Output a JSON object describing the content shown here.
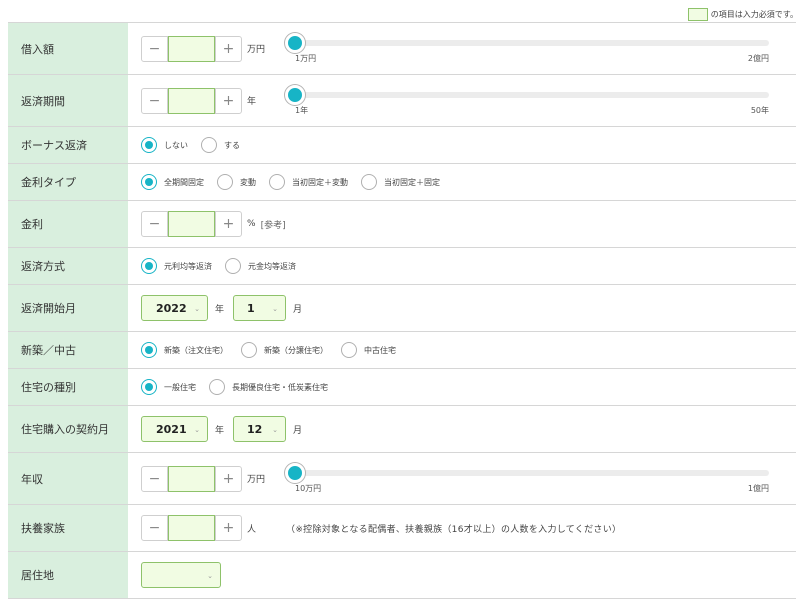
{
  "required_note": "の項目は入力必須です。",
  "colors": {
    "label_bg": "#d9efde",
    "required_bg": "#f1fce3",
    "required_border": "#8ec26a",
    "accent": "#17b4c6"
  },
  "loan_amount": {
    "label": "借入額",
    "minus": "−",
    "plus": "+",
    "value": "",
    "unit": "万円",
    "slider_min": "1万円",
    "slider_max": "2億円",
    "slider_fraction": 0
  },
  "term": {
    "label": "返済期間",
    "minus": "−",
    "plus": "+",
    "value": "",
    "unit": "年",
    "slider_min": "1年",
    "slider_max": "50年",
    "slider_fraction": 0
  },
  "bonus": {
    "label": "ボーナス返済",
    "options": [
      "しない",
      "する"
    ],
    "selected": 0
  },
  "rate_type": {
    "label": "金利タイプ",
    "options": [
      "全期間固定",
      "変動",
      "当初固定＋変動",
      "当初固定＋固定"
    ],
    "selected": 0
  },
  "rate": {
    "label": "金利",
    "minus": "−",
    "plus": "+",
    "value": "",
    "unit": "%",
    "ref": "[参考]"
  },
  "method": {
    "label": "返済方式",
    "options": [
      "元利均等返済",
      "元金均等返済"
    ],
    "selected": 0
  },
  "start_month": {
    "label": "返済開始月",
    "year": "2022",
    "year_unit": "年",
    "month": "1",
    "month_unit": "月"
  },
  "new_used": {
    "label": "新築／中古",
    "options": [
      "新築（注文住宅）",
      "新築（分譲住宅）",
      "中古住宅"
    ],
    "selected": 0
  },
  "house_type": {
    "label": "住宅の種別",
    "options": [
      "一般住宅",
      "長期優良住宅・低炭素住宅"
    ],
    "selected": 0
  },
  "contract": {
    "label": "住宅購入の契約月",
    "year": "2021",
    "year_unit": "年",
    "month": "12",
    "month_unit": "月"
  },
  "income": {
    "label": "年収",
    "minus": "−",
    "plus": "+",
    "value": "",
    "unit": "万円",
    "slider_min": "10万円",
    "slider_max": "1億円",
    "slider_fraction": 0
  },
  "dependents": {
    "label": "扶養家族",
    "minus": "−",
    "plus": "+",
    "value": "",
    "unit": "人",
    "note": "（※控除対象となる配偶者、扶養親族（16才以上）の人数を入力してください）"
  },
  "residence": {
    "label": "居住地",
    "value": ""
  }
}
